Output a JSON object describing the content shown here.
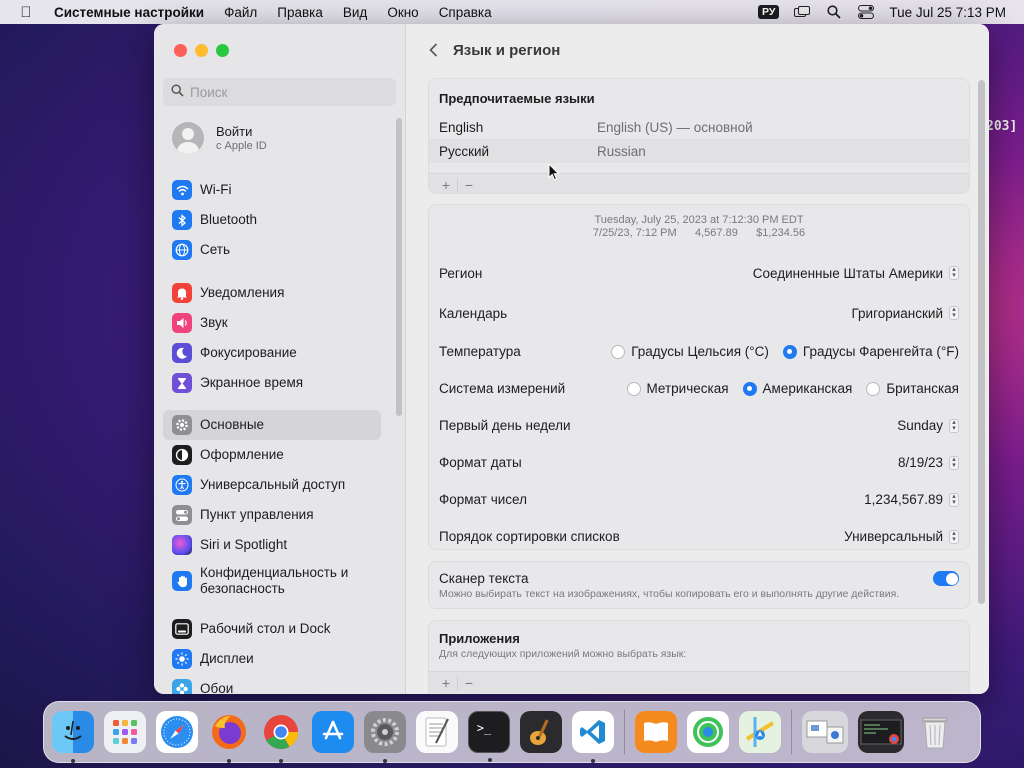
{
  "menubar": {
    "app_name": "Системные настройки",
    "items": [
      "Файл",
      "Правка",
      "Вид",
      "Окно",
      "Справка"
    ],
    "input_source": "РУ",
    "clock": "Tue Jul 25  7:13 PM"
  },
  "sidebar": {
    "search_placeholder": "Поиск",
    "account": {
      "title": "Войти",
      "subtitle": "с Apple ID"
    },
    "groups": [
      [
        {
          "label": "Wi-Fi",
          "icon": "wifi-icon",
          "color": "#1e79f2"
        },
        {
          "label": "Bluetooth",
          "icon": "bluetooth-icon",
          "color": "#1e79f2"
        },
        {
          "label": "Сеть",
          "icon": "globe-icon",
          "color": "#1e79f2"
        }
      ],
      [
        {
          "label": "Уведомления",
          "icon": "bell-icon",
          "color": "#f2433a"
        },
        {
          "label": "Звук",
          "icon": "speaker-icon",
          "color": "#f0427b"
        },
        {
          "label": "Фокусирование",
          "icon": "moon-icon",
          "color": "#5b4fd8"
        },
        {
          "label": "Экранное время",
          "icon": "hourglass-icon",
          "color": "#6d4fd8"
        }
      ],
      [
        {
          "label": "Основные",
          "icon": "gear-icon",
          "color": "#8e8e93",
          "active": true
        },
        {
          "label": "Оформление",
          "icon": "appearance-icon",
          "color": "#1d1d1f"
        },
        {
          "label": "Универсальный доступ",
          "icon": "accessibility-icon",
          "color": "#1e79f2"
        },
        {
          "label": "Пункт управления",
          "icon": "toggles-icon",
          "color": "#8e8e93"
        },
        {
          "label": "Siri и Spotlight",
          "icon": "siri-icon",
          "color": "#7a3fd0"
        },
        {
          "label": "Конфиденциальность и безопасность",
          "icon": "hand-icon",
          "color": "#1e79f2"
        }
      ],
      [
        {
          "label": "Рабочий стол и Dock",
          "icon": "dock-icon",
          "color": "#1d1d1f"
        },
        {
          "label": "Дисплеи",
          "icon": "sun-icon",
          "color": "#1e79f2"
        },
        {
          "label": "Обои",
          "icon": "flower-icon",
          "color": "#3aa4e8"
        }
      ]
    ]
  },
  "page": {
    "title": "Язык и регион",
    "preferred": {
      "heading": "Предпочитаемые языки",
      "languages": [
        {
          "name": "English",
          "detail": "English (US) — основной"
        },
        {
          "name": "Русский",
          "detail": "Russian"
        }
      ]
    },
    "preview": {
      "line1": "Tuesday, July 25, 2023 at 7:12:30 PM EDT",
      "line2": "7/25/23, 7:12 PM      4,567.89      $1,234.56"
    },
    "settings": {
      "region": {
        "label": "Регион",
        "value": "Соединенные Штаты Америки"
      },
      "calendar": {
        "label": "Календарь",
        "value": "Григорианский"
      },
      "temperature": {
        "label": "Температура",
        "options": [
          "Градусы Цельсия (°C)",
          "Градусы Фаренгейта (°F)"
        ],
        "selected": "Градусы Фаренгейта (°F)"
      },
      "measurement": {
        "label": "Система измерений",
        "options": [
          "Метрическая",
          "Американская",
          "Британская"
        ],
        "selected": "Американская"
      },
      "first_day": {
        "label": "Первый день недели",
        "value": "Sunday"
      },
      "date_format": {
        "label": "Формат даты",
        "value": "8/19/23"
      },
      "number_format": {
        "label": "Формат чисел",
        "value": "1,234,567.89"
      },
      "sort_order": {
        "label": "Порядок сортировки списков",
        "value": "Универсальный"
      }
    },
    "live_text": {
      "label": "Сканер текста",
      "description": "Можно выбирать текст на изображениях, чтобы копировать его и выполнять другие действия.",
      "enabled": true
    },
    "apps": {
      "heading": "Приложения",
      "description": "Для следующих приложений можно выбрать язык:"
    }
  },
  "desktop_edge_text": "203]",
  "dock": {
    "apps": [
      "finder-icon",
      "launchpad-icon",
      "safari-icon",
      "firefox-icon",
      "chrome-icon",
      "app-store-icon",
      "system-settings-icon",
      "textedit-icon",
      "terminal-icon",
      "garageband-icon",
      "vscode-icon"
    ],
    "apps2": [
      "books-icon",
      "find-my-icon",
      "maps-icon"
    ],
    "recent": [
      "preview-window-icon",
      "terminal-window-icon",
      "trash-icon"
    ]
  }
}
